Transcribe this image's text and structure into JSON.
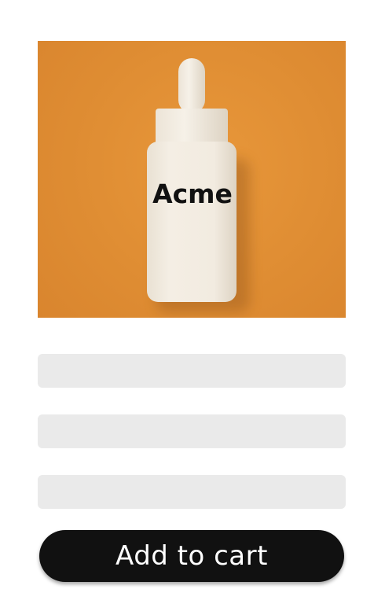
{
  "product": {
    "image_label": "Acme",
    "background_color": "#df8d33"
  },
  "skeleton_placeholders": 3,
  "actions": {
    "add_to_cart_label": "Add to cart"
  }
}
